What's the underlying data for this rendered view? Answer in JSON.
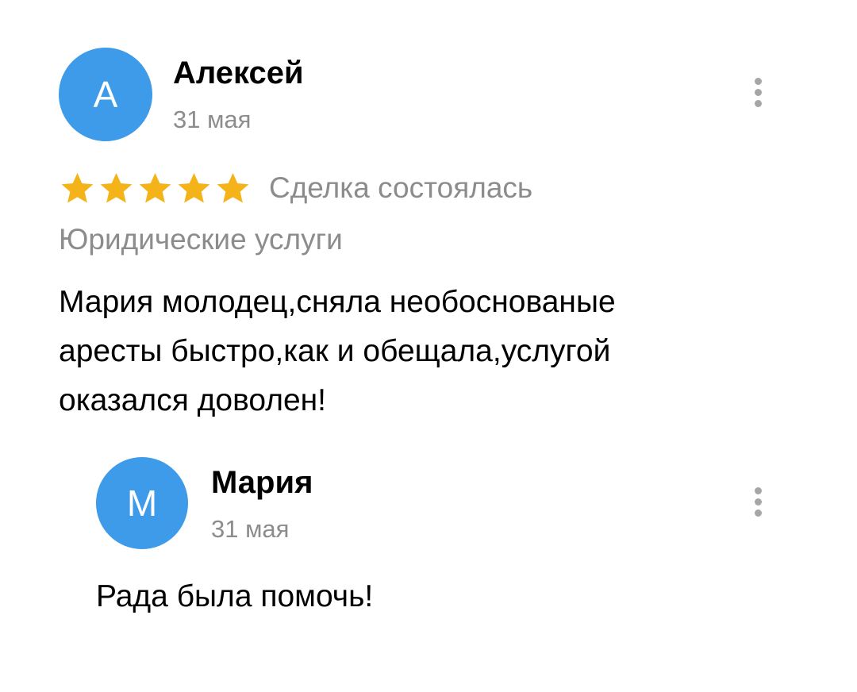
{
  "colors": {
    "avatar_background": "#3d9be9",
    "star": "#f5b31a",
    "secondary_text": "#8c8c8c",
    "more_dots": "#a6a6a6"
  },
  "review": {
    "avatar_letter": "А",
    "author": "Алексей",
    "date": "31 мая",
    "rating": 5,
    "rating_max": 5,
    "deal_status": "Сделка состоялась",
    "category": "Юридические услуги",
    "text": "Мария молодец,сняла необоснованые\nаресты быстро,как и обещала,услугой\nоказался доволен!",
    "more_icon": "more-vertical-icon"
  },
  "reply": {
    "avatar_letter": "М",
    "author": "Мария",
    "date": "31 мая",
    "text": "Рада была помочь!",
    "more_icon": "more-vertical-icon"
  }
}
